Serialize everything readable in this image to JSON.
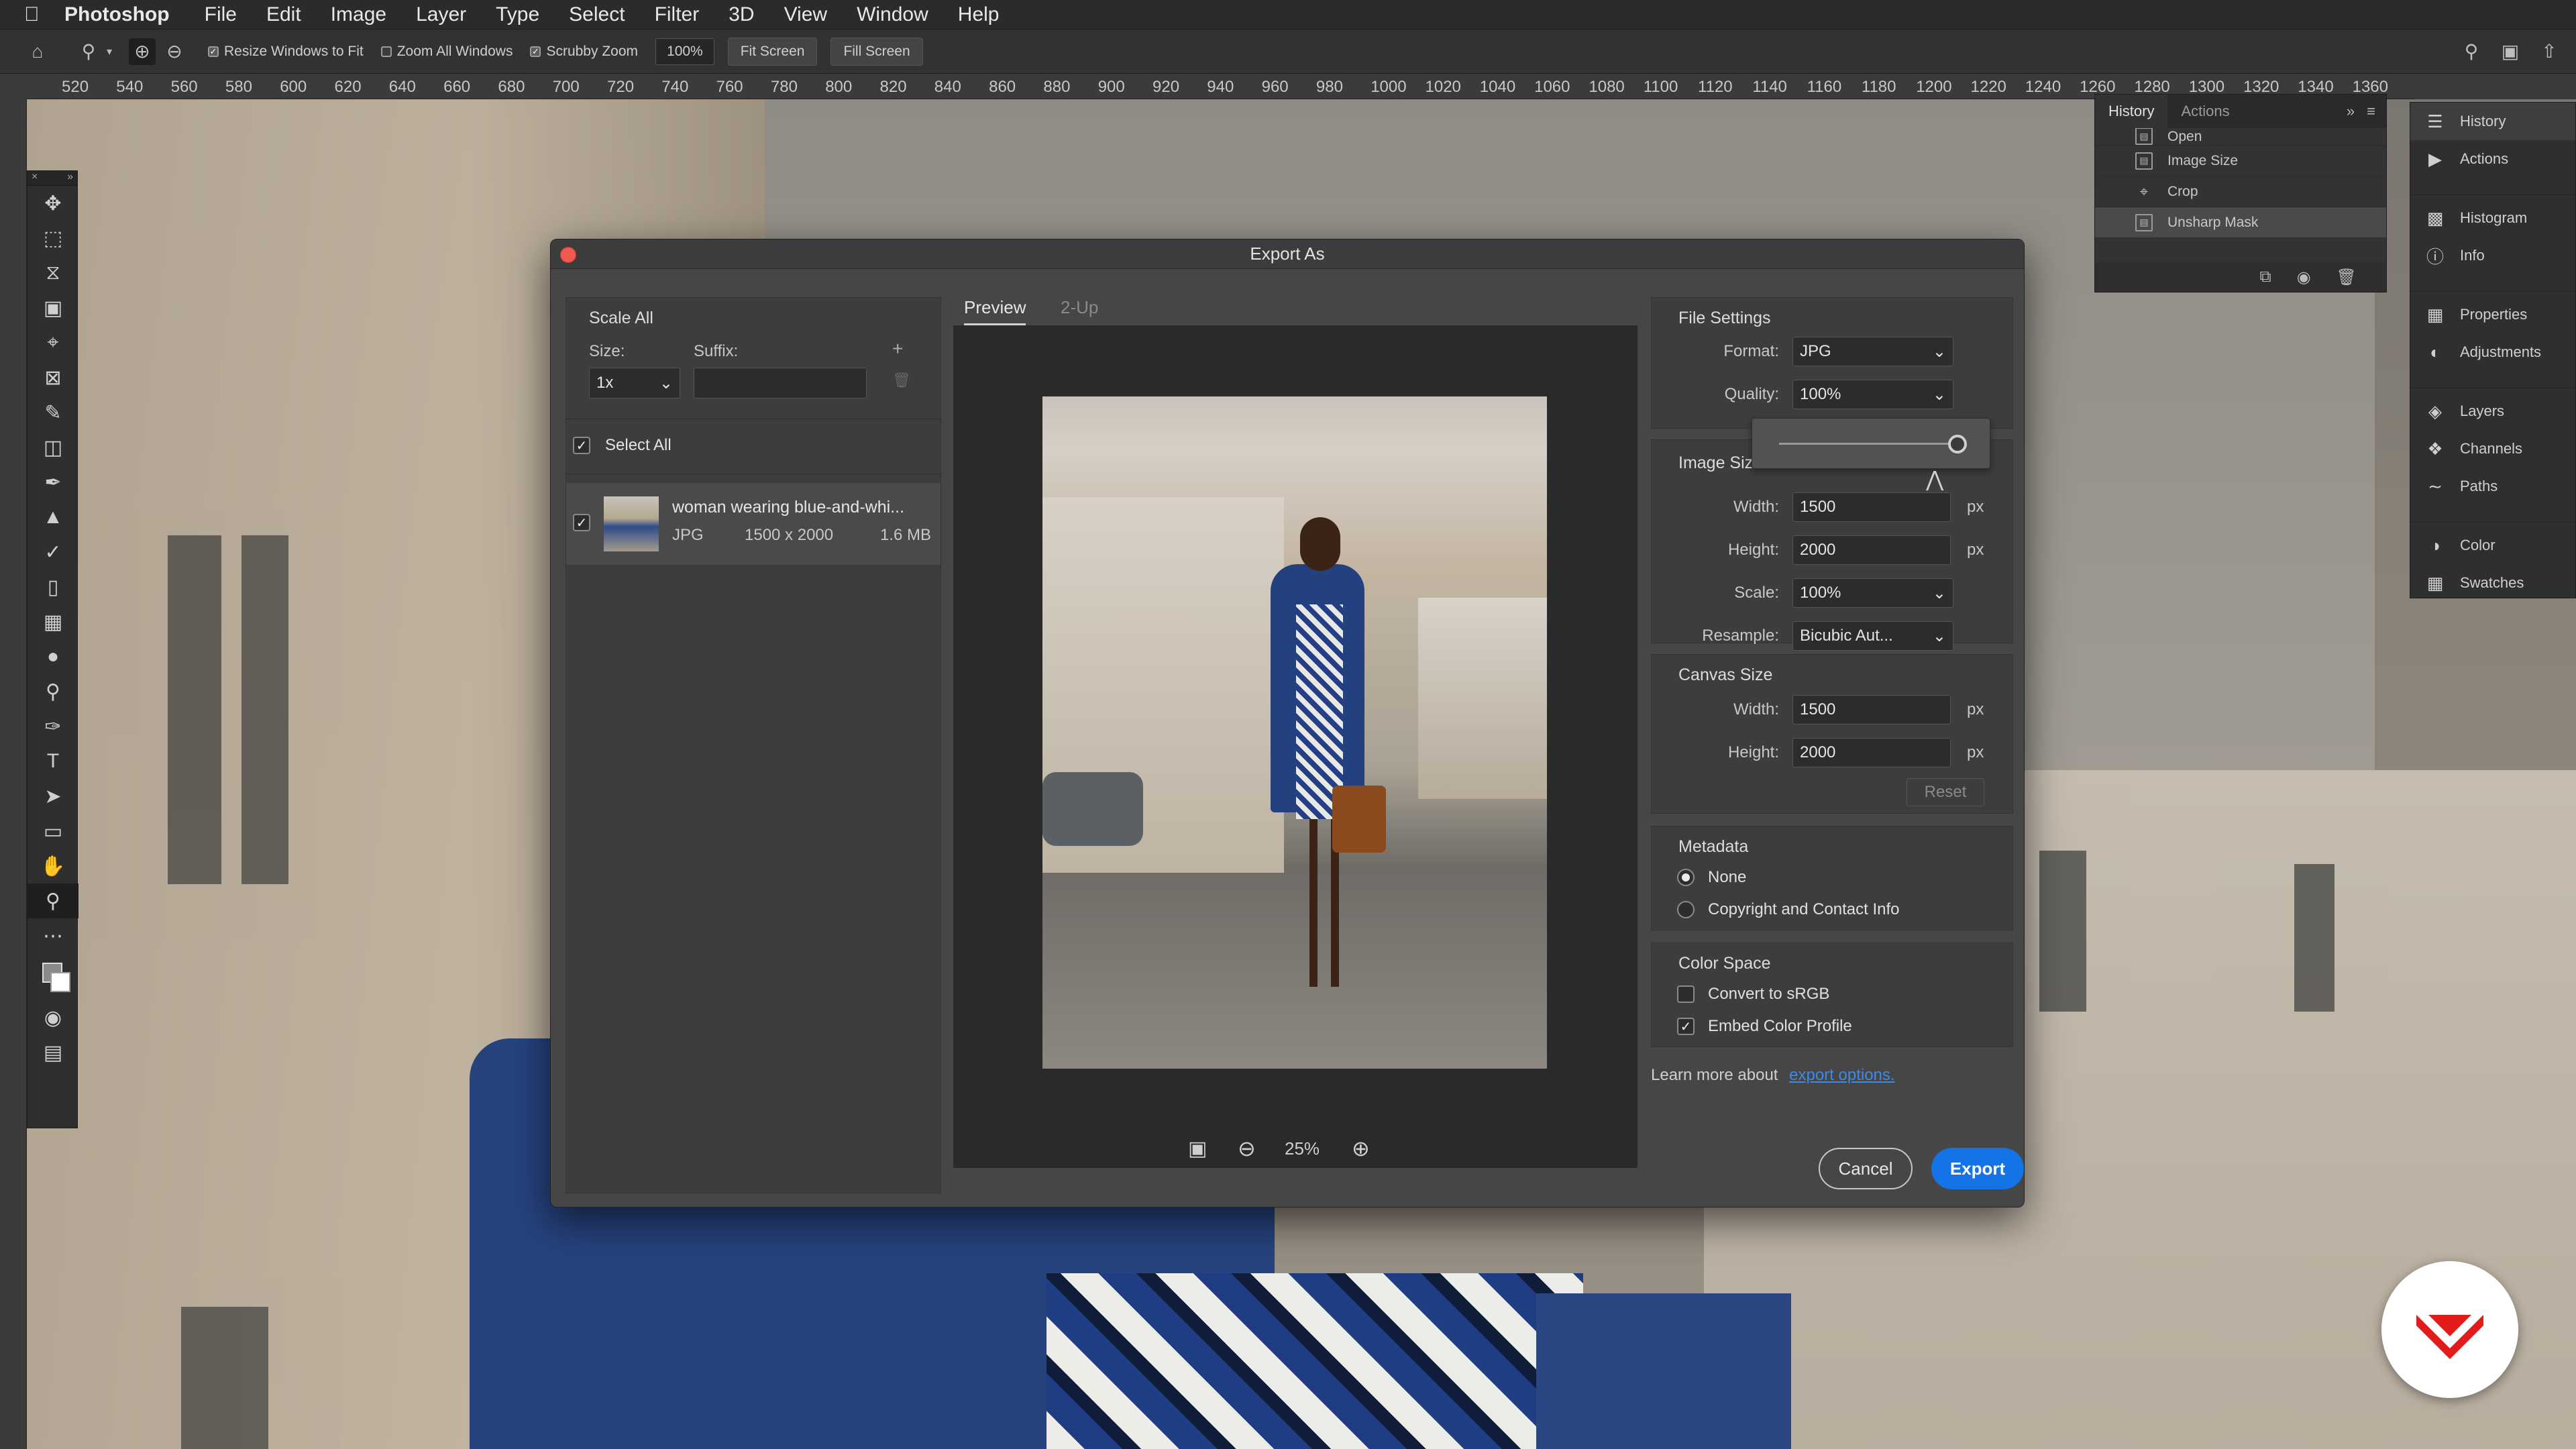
{
  "menubar": {
    "app": "Photoshop",
    "items": [
      "File",
      "Edit",
      "Image",
      "Layer",
      "Type",
      "Select",
      "Filter",
      "3D",
      "View",
      "Window",
      "Help"
    ]
  },
  "options_bar": {
    "resize_windows": "Resize Windows to Fit",
    "zoom_all": "Zoom All Windows",
    "scrubby_zoom": "Scrubby Zoom",
    "zoom_value": "100%",
    "fit_screen": "Fit Screen",
    "fill_screen": "Fill Screen",
    "resize_windows_checked": true,
    "zoom_all_checked": false,
    "scrubby_zoom_checked": true
  },
  "ruler": {
    "ticks": [
      "520",
      "540",
      "560",
      "580",
      "600",
      "620",
      "640",
      "660",
      "680",
      "700",
      "720",
      "740",
      "760",
      "780",
      "800",
      "820",
      "840",
      "860",
      "880",
      "900",
      "920",
      "940",
      "960",
      "980",
      "1000",
      "1020",
      "1040",
      "1060",
      "1080",
      "1100",
      "1120",
      "1140",
      "1160",
      "1180",
      "1200",
      "1220",
      "1240",
      "1260",
      "1280",
      "1300",
      "1320",
      "1340",
      "1360"
    ]
  },
  "history_panel": {
    "tabs": [
      "History",
      "Actions"
    ],
    "active_tab": "History",
    "rows": [
      "Open",
      "Image Size",
      "Crop",
      "Unsharp Mask"
    ],
    "selected_row": "Unsharp Mask"
  },
  "dock": {
    "items": [
      "History",
      "Actions",
      "Histogram",
      "Info",
      "Properties",
      "Adjustments",
      "Layers",
      "Channels",
      "Paths",
      "Color",
      "Swatches"
    ],
    "icons": [
      "history-icon",
      "play-icon",
      "histogram-icon",
      "info-icon",
      "properties-icon",
      "adjustments-icon",
      "layers-icon",
      "channels-icon",
      "paths-icon",
      "color-icon",
      "swatches-icon"
    ]
  },
  "dialog": {
    "title": "Export As",
    "scale_all": {
      "title": "Scale All",
      "size_label": "Size:",
      "suffix_label": "Suffix:",
      "size_value": "1x",
      "suffix_value": ""
    },
    "select_all": "Select All",
    "asset": {
      "name": "woman wearing blue-and-whi...",
      "format": "JPG",
      "dimensions": "1500 x 2000",
      "filesize": "1.6 MB"
    },
    "tabs": [
      "Preview",
      "2-Up"
    ],
    "active_tab": "Preview",
    "zoom": "25%",
    "file_settings": {
      "title": "File Settings",
      "format_label": "Format:",
      "format_value": "JPG",
      "quality_label": "Quality:",
      "quality_value": "100%",
      "quality_slider": 1.0
    },
    "image_size": {
      "title": "Image Size",
      "width_label": "Width:",
      "width_value": "1500",
      "height_label": "Height:",
      "height_value": "2000",
      "scale_label": "Scale:",
      "scale_value": "100%",
      "resample_label": "Resample:",
      "resample_value": "Bicubic Aut...",
      "unit": "px"
    },
    "canvas_size": {
      "title": "Canvas Size",
      "width_label": "Width:",
      "width_value": "1500",
      "height_label": "Height:",
      "height_value": "2000",
      "unit": "px",
      "reset": "Reset"
    },
    "metadata": {
      "title": "Metadata",
      "options": [
        "None",
        "Copyright and Contact Info"
      ],
      "selected": "None"
    },
    "color_space": {
      "title": "Color Space",
      "convert_srgb": "Convert to sRGB",
      "embed_profile": "Embed Color Profile",
      "convert_checked": false,
      "embed_checked": true
    },
    "learn_more": "Learn more about",
    "learn_link": "export options.",
    "cancel": "Cancel",
    "export": "Export"
  },
  "colors": {
    "accent": "#1473e6",
    "link": "#3d8ae8",
    "close": "#ee5a52",
    "logo_red": "#e21b1b"
  }
}
